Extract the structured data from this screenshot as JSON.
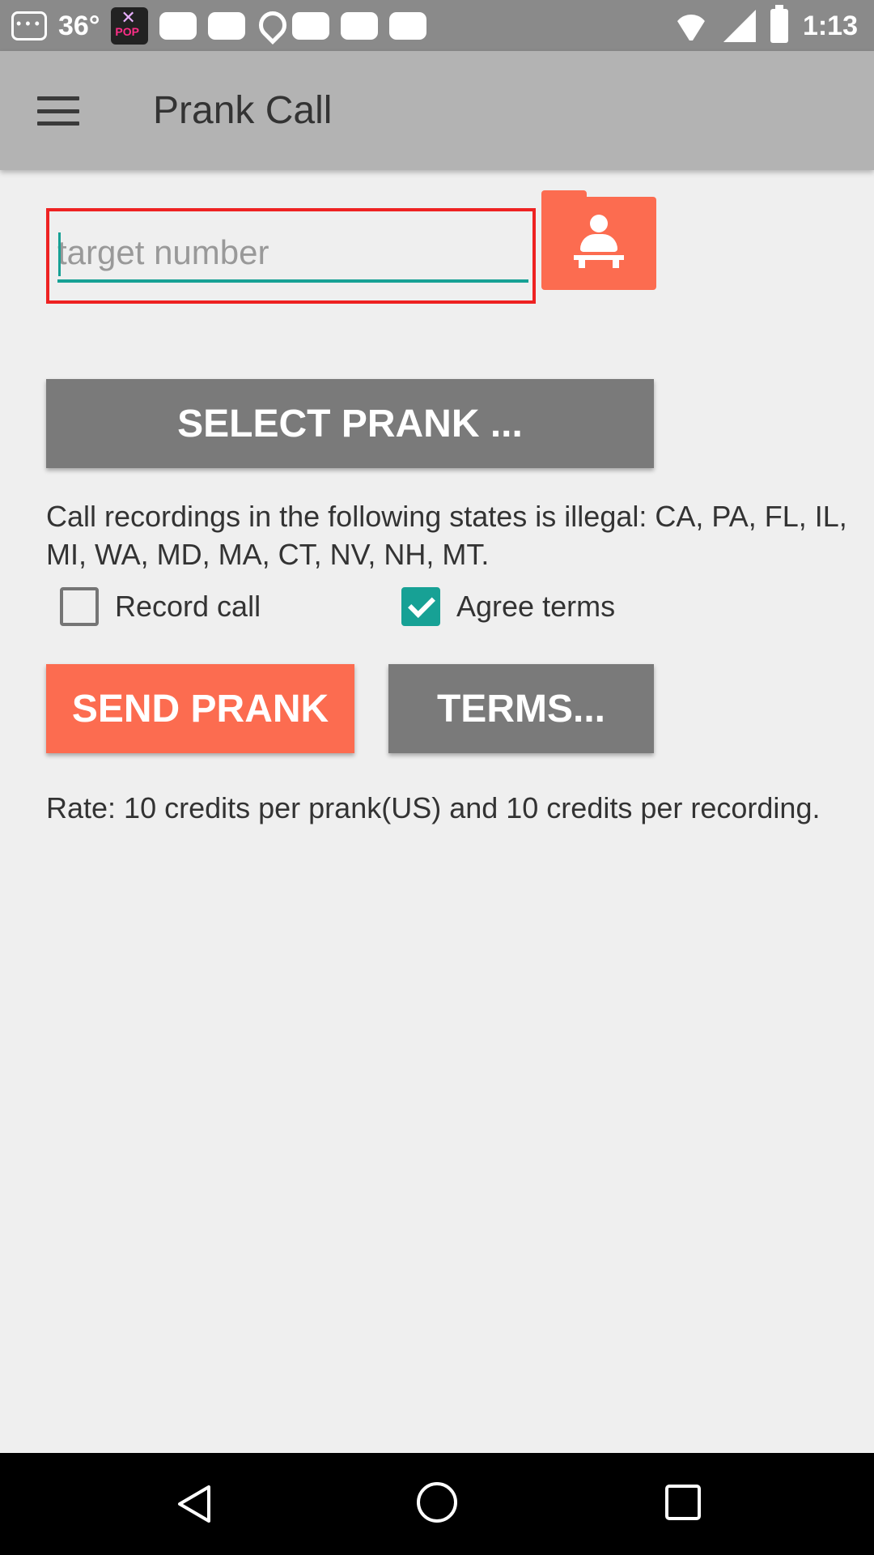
{
  "status_bar": {
    "temperature": "36°",
    "time": "1:13",
    "icons": [
      "notification-dots-icon",
      "pop-app-icon",
      "rounded-rect-icon",
      "location-pin-icon",
      "rounded-rect-icon",
      "rounded-rect-icon",
      "rounded-rect-icon",
      "wifi-icon",
      "signal-icon",
      "battery-icon"
    ]
  },
  "app_bar": {
    "title": "Prank Call",
    "menu_icon": "hamburger-menu-icon"
  },
  "target": {
    "placeholder": "target number",
    "value": "",
    "contact_icon": "contact-book-icon"
  },
  "buttons": {
    "select_prank": "SELECT PRANK ...",
    "send_prank": "SEND PRANK",
    "terms": "TERMS..."
  },
  "notice": "Call recordings in the following states is illegal: CA, PA, FL, IL, MI, WA, MD, MA, CT, NV, NH, MT.",
  "checkboxes": {
    "record_call": {
      "label": "Record call",
      "checked": false
    },
    "agree_terms": {
      "label": "Agree terms",
      "checked": true
    }
  },
  "rate_text": "Rate: 10 credits per prank(US) and 10 credits per recording.",
  "colors": {
    "accent": "#fc6c50",
    "teal": "#17a195",
    "button_gray": "#7a7a7a",
    "app_bar": "#b3b3b3",
    "highlight_border": "#e22"
  },
  "nav_bar": {
    "icons": [
      "back-icon",
      "home-icon",
      "recent-apps-icon"
    ]
  }
}
